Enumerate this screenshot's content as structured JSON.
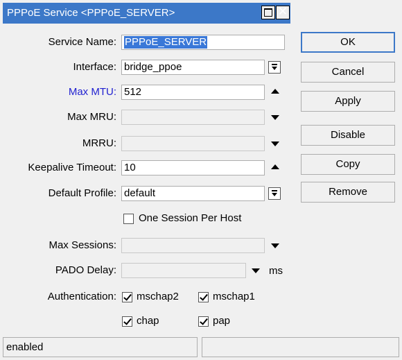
{
  "window": {
    "title": "PPPoE Service <PPPoE_SERVER>"
  },
  "form": {
    "service_name_label": "Service Name:",
    "service_name_value": "PPPoE_SERVER",
    "interface_label": "Interface:",
    "interface_value": "bridge_ppoe",
    "max_mtu_label": "Max MTU:",
    "max_mtu_value": "512",
    "max_mru_label": "Max MRU:",
    "max_mru_value": "",
    "mrru_label": "MRRU:",
    "mrru_value": "",
    "keepalive_label": "Keepalive Timeout:",
    "keepalive_value": "10",
    "default_profile_label": "Default Profile:",
    "default_profile_value": "default",
    "one_session_label": "One Session Per Host",
    "one_session_checked": false,
    "max_sessions_label": "Max Sessions:",
    "max_sessions_value": "",
    "pado_delay_label": "PADO Delay:",
    "pado_delay_value": "",
    "pado_delay_unit": "ms",
    "auth_label": "Authentication:",
    "auth_options": [
      {
        "label": "mschap2",
        "checked": true
      },
      {
        "label": "mschap1",
        "checked": true
      },
      {
        "label": "chap",
        "checked": true
      },
      {
        "label": "pap",
        "checked": true
      }
    ]
  },
  "buttons": {
    "ok": "OK",
    "cancel": "Cancel",
    "apply": "Apply",
    "disable": "Disable",
    "copy": "Copy",
    "remove": "Remove"
  },
  "status": {
    "left": "enabled",
    "right": ""
  },
  "colors": {
    "title_bar": "#3c78c8",
    "mtu_label": "#1f1fd0",
    "selection": "#3a78d8"
  }
}
